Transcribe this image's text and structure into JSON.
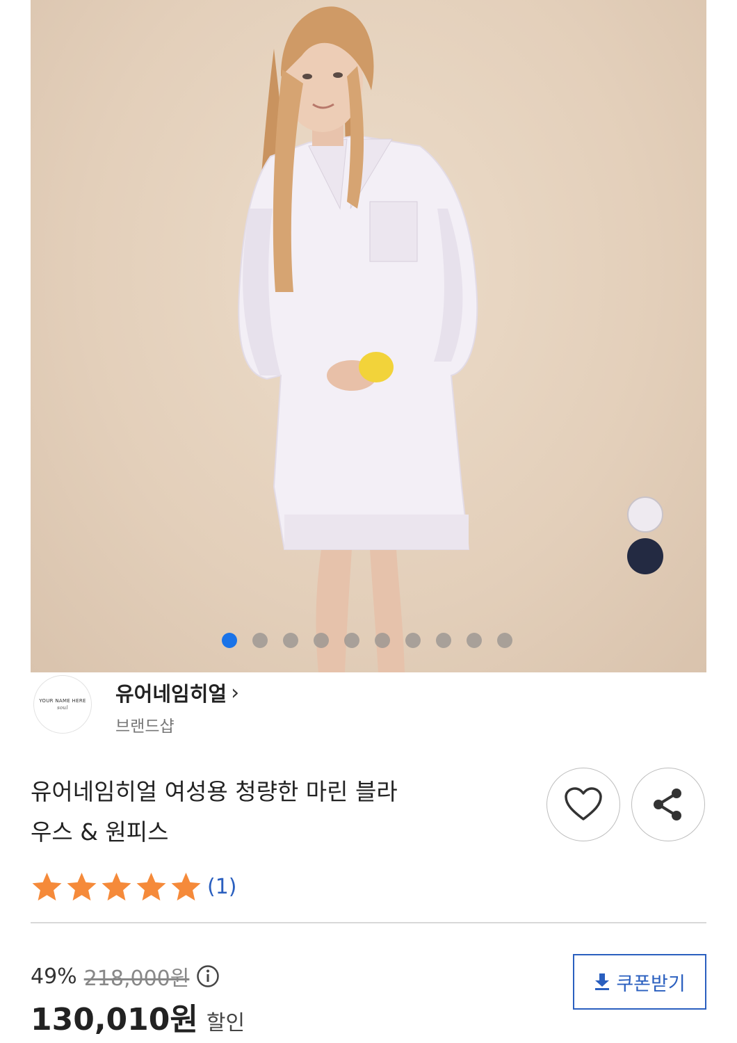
{
  "gallery": {
    "swatch_colors": [
      "#eeeaf0",
      "#232a42"
    ],
    "dot_count": 10,
    "active_index": 0
  },
  "brand": {
    "logo_text": "YOUR NAME HERE",
    "logo_sig": "soul",
    "name": "유어네임히얼",
    "chevron": "›",
    "type": "브랜드샵"
  },
  "product": {
    "title_line1": "유어네임히얼 여성용 청량한 마린 블라",
    "title_line2": "우스 & 원피스",
    "rating_stars": 5,
    "review_count": "(1)",
    "star_color": "#f58a3a"
  },
  "price": {
    "discount": "49%",
    "original": "218,000원",
    "final": "130,010원",
    "final_label": "할인"
  },
  "coupon": {
    "label": "쿠폰받기",
    "icon": "download-icon"
  },
  "icons": {
    "wish": "heart-icon",
    "share": "share-icon",
    "info": "info-icon"
  }
}
